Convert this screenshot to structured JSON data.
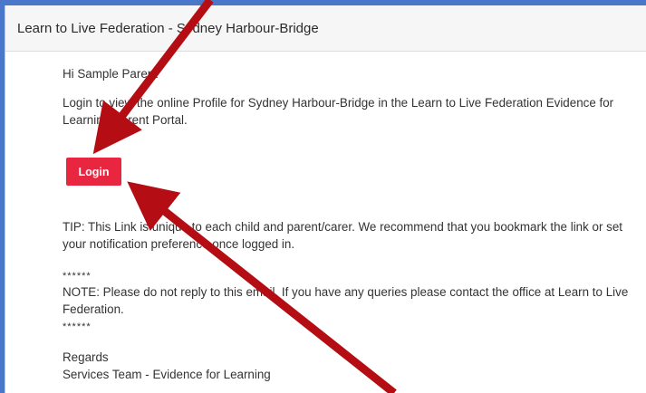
{
  "header": {
    "title": "Learn to Live Federation - Sydney Harbour-Bridge"
  },
  "email": {
    "greeting": "Hi Sample Parent",
    "intro": "Login to view the online Profile for Sydney Harbour-Bridge in the Learn to Live Federation Evidence for Learning Parent Portal.",
    "login_label": "Login",
    "tip": "TIP: This Link is unique to each child and parent/carer. We recommend that you bookmark the link or set your notification preference once logged in.",
    "separator_top": "******",
    "note": "NOTE: Please do not reply to this email. If you have any queries please contact the office at Learn to Live Federation.",
    "separator_bottom": "******",
    "regards": "Regards",
    "signature": "Services Team - Evidence for Learning"
  },
  "colors": {
    "frame": "#4a77c9",
    "button": "#e8263f",
    "arrow": "#b50d14"
  }
}
